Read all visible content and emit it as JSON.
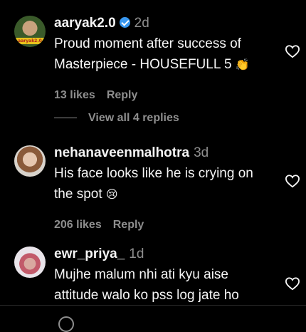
{
  "comments": [
    {
      "username": "aaryak2.0",
      "verified": true,
      "time": "2d",
      "avatar_tag": "aaryak2.0",
      "text_line1": "Proud moment after success of",
      "text_line2": "Masterpiece - HOUSEFULL 5",
      "emoji": "👏",
      "likes": "13 likes",
      "reply_label": "Reply"
    },
    {
      "username": "nehanaveenmalhotra",
      "time": "3d",
      "text_line1": "His face looks like he is crying on",
      "text_line2": "the spot",
      "emoji": "😢",
      "likes": "206 likes",
      "reply_label": "Reply"
    },
    {
      "username": "ewr_priya_",
      "time": "1d",
      "text_line1": "Mujhe malum nhi ati kyu aise",
      "text_line2": "attitude walo ko pss log jate ho"
    }
  ],
  "view_replies": "View all 4 replies"
}
